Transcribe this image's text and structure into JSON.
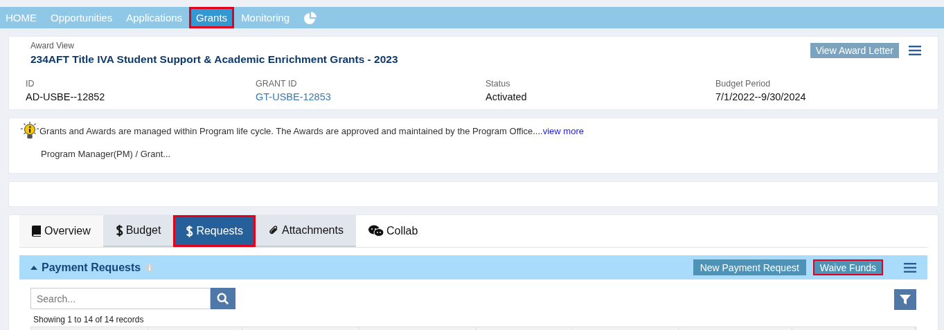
{
  "nav": {
    "items": [
      {
        "label": "HOME",
        "selected": false,
        "highlighted": false
      },
      {
        "label": "Opportunities",
        "selected": false,
        "highlighted": false
      },
      {
        "label": "Applications",
        "selected": false,
        "highlighted": false
      },
      {
        "label": "Grants",
        "selected": true,
        "highlighted": true
      },
      {
        "label": "Monitoring",
        "selected": false,
        "highlighted": false
      }
    ]
  },
  "award": {
    "caption": "Award View",
    "title": "234AFT Title IVA Student Support & Academic Enrichment Grants - 2023",
    "button": "View Award Letter",
    "fields": [
      {
        "label": "ID",
        "value": "AD-USBE--12852",
        "kind": "text"
      },
      {
        "label": "GRANT ID",
        "value": "GT-USBE-12853",
        "kind": "link"
      },
      {
        "label": "Status",
        "value": "Activated",
        "kind": "text"
      },
      {
        "label": "Budget Period",
        "value": "7/1/2022--9/30/2024",
        "kind": "text"
      }
    ]
  },
  "info": {
    "text": "Grants and Awards are managed within Program life cycle. The Awards are approved and maintained by the Program Office...",
    "link": ".view more",
    "second_line": "Program Manager(PM) / Grant..."
  },
  "tabs": [
    {
      "label": "Overview",
      "kind": "book",
      "selected": false,
      "shaded": false,
      "highlighted": false
    },
    {
      "label": "Budget",
      "kind": "dollar",
      "selected": false,
      "shaded": true,
      "highlighted": false
    },
    {
      "label": "Requests",
      "kind": "dollar",
      "selected": true,
      "shaded": false,
      "highlighted": true
    },
    {
      "label": "Attachments",
      "kind": "clip",
      "selected": false,
      "shaded": true,
      "highlighted": false
    },
    {
      "label": "Collab",
      "kind": "chat",
      "selected": false,
      "shaded": false,
      "highlighted": false
    }
  ],
  "section": {
    "title": "Payment Requests",
    "buttons": [
      {
        "label": "New Payment Request",
        "highlighted": false
      },
      {
        "label": "Waive Funds",
        "highlighted": true
      }
    ],
    "search": {
      "placeholder": "Search..."
    },
    "records": "Showing 1 to 14 of 14 records"
  }
}
